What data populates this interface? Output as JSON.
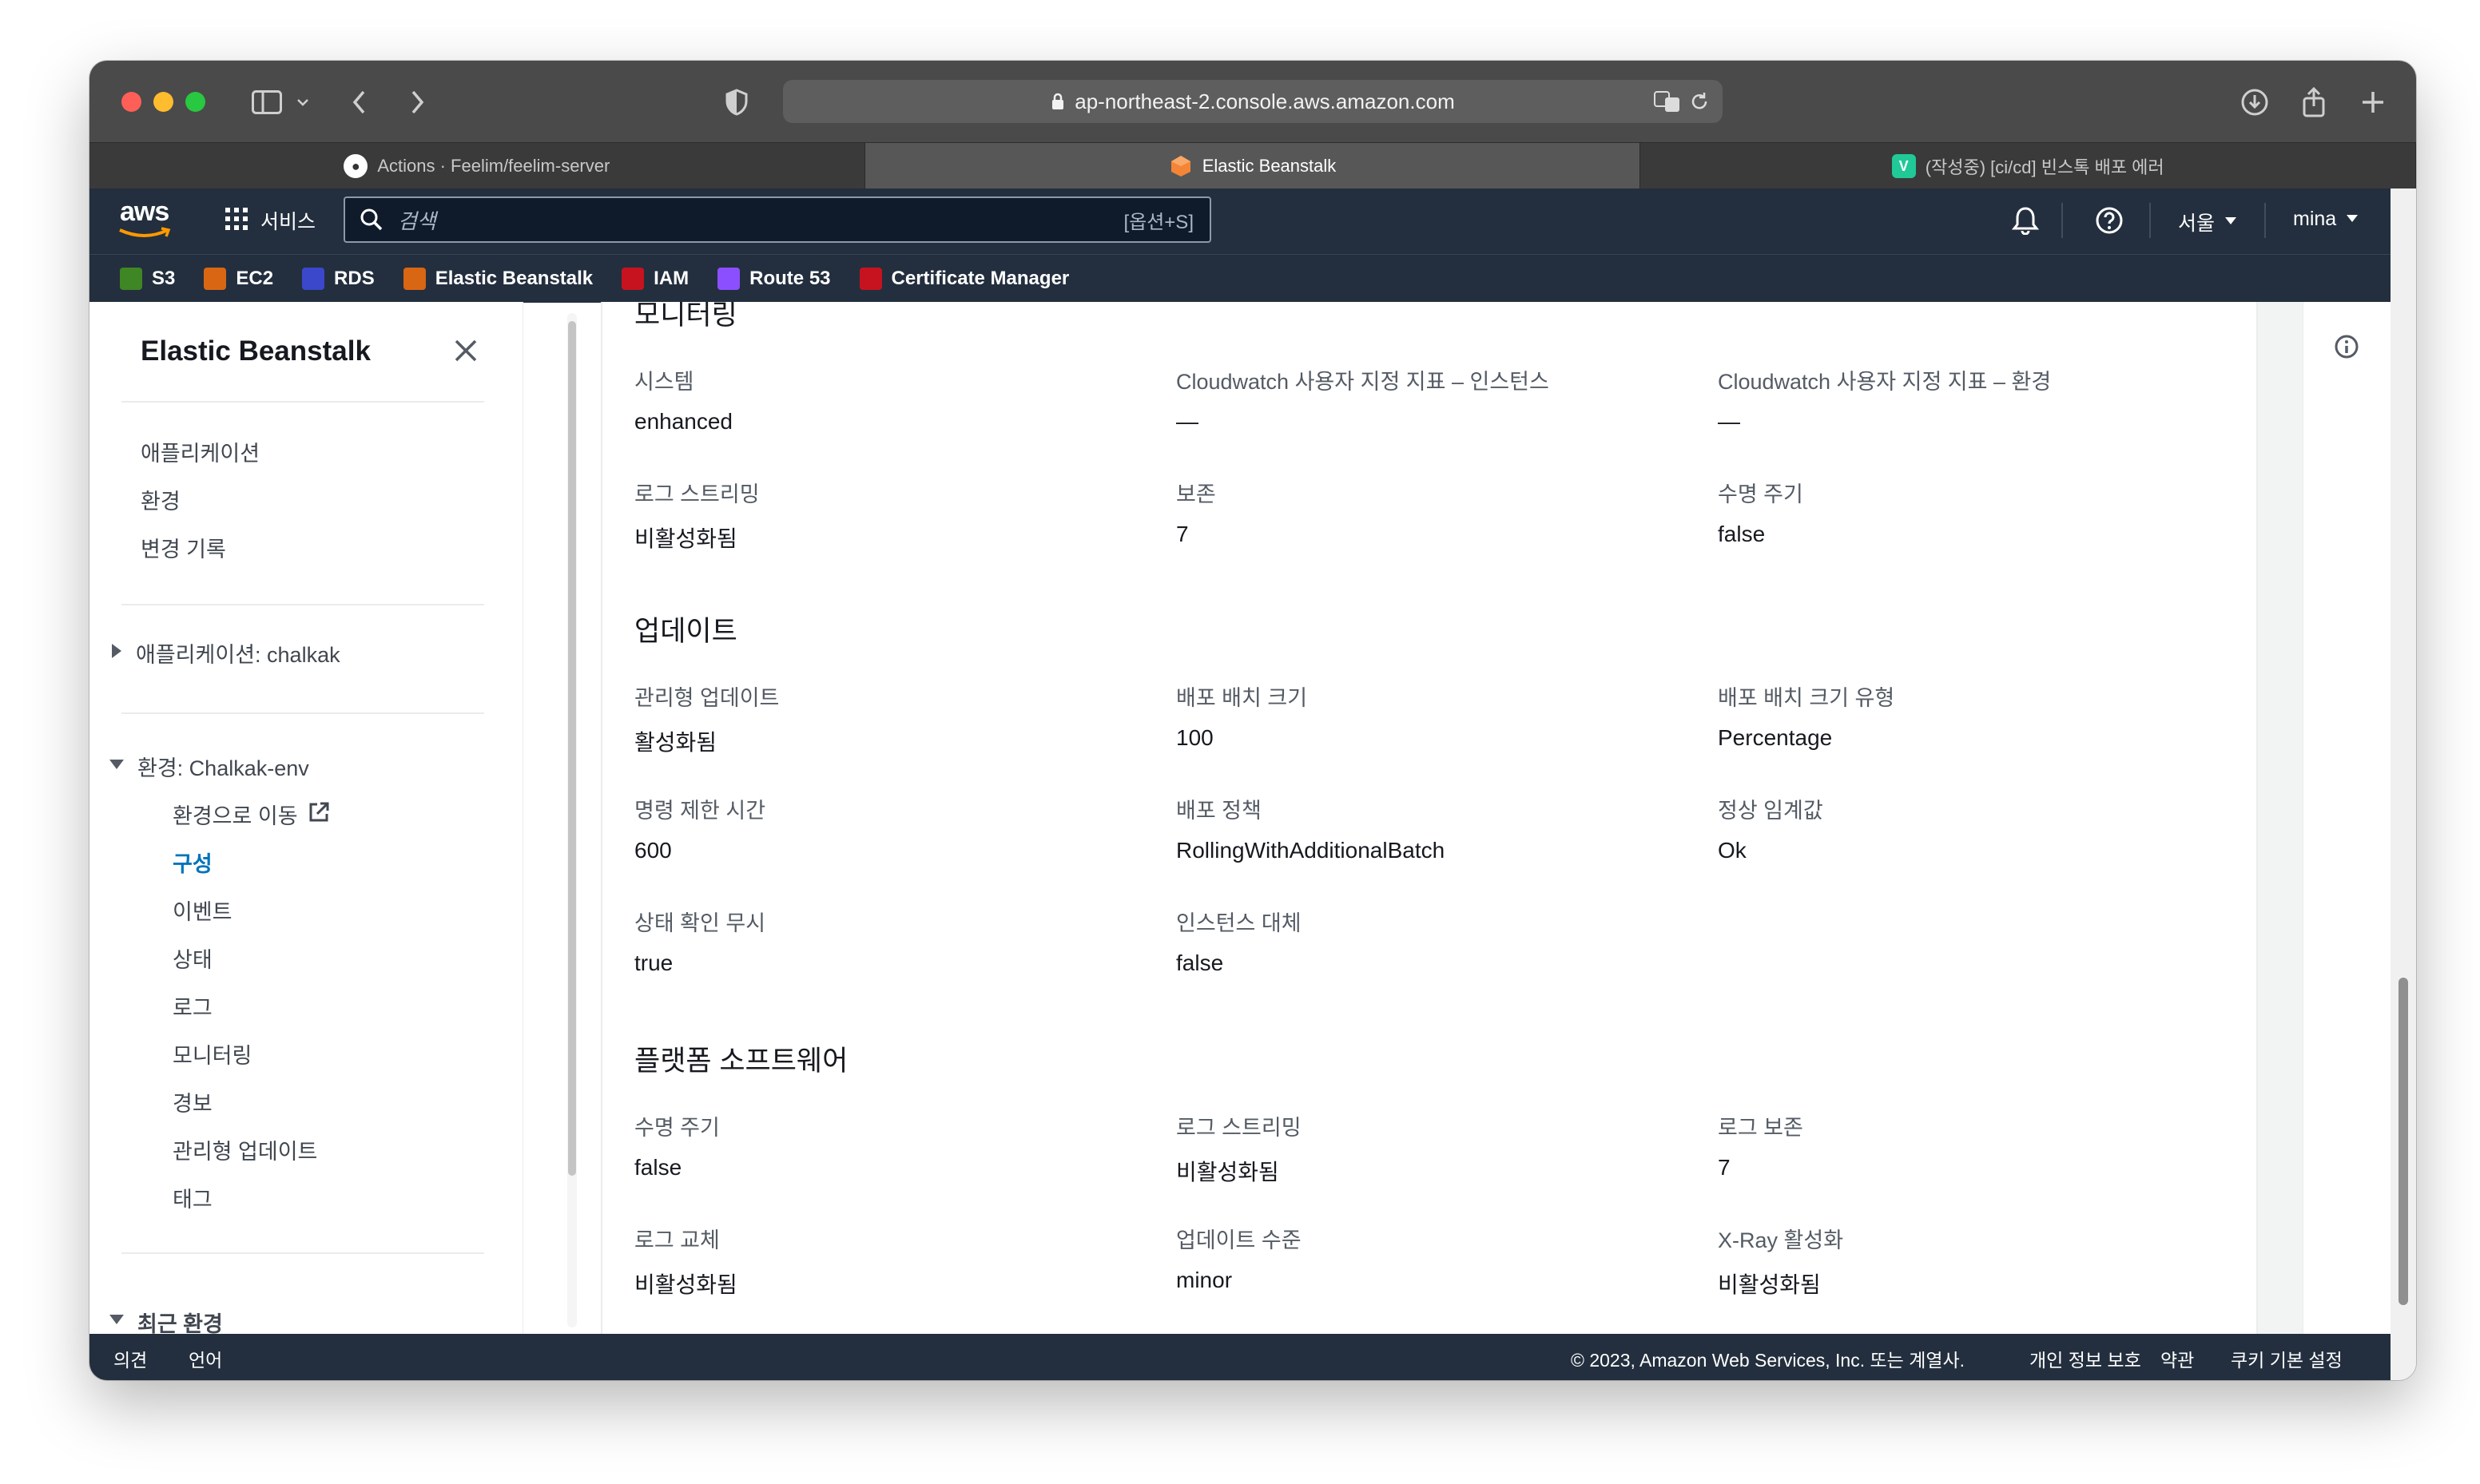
{
  "browser": {
    "url": "ap-northeast-2.console.aws.amazon.com",
    "tabs": [
      {
        "label": "Actions · Feelim/feelim-server",
        "icon": "github-icon",
        "active": false
      },
      {
        "label": "Elastic Beanstalk",
        "icon": "beanstalk-icon",
        "active": true
      },
      {
        "label": "(작성중) [ci/cd] 빈스톡 배포 에러",
        "icon": "velog-icon",
        "active": false
      }
    ]
  },
  "header": {
    "logo": "aws",
    "services": "서비스",
    "search_placeholder": "검색",
    "search_shortcut": "[옵션+S]",
    "region": "서울",
    "user": "mina"
  },
  "favorites": [
    {
      "label": "S3",
      "color": "#3f8624"
    },
    {
      "label": "EC2",
      "color": "#d86613"
    },
    {
      "label": "RDS",
      "color": "#3b48cc"
    },
    {
      "label": "Elastic Beanstalk",
      "color": "#d86613"
    },
    {
      "label": "IAM",
      "color": "#c7131f"
    },
    {
      "label": "Route 53",
      "color": "#8c4fff"
    },
    {
      "label": "Certificate Manager",
      "color": "#c7131f"
    }
  ],
  "sidebar": {
    "title": "Elastic Beanstalk",
    "top_items": [
      "애플리케이션",
      "환경",
      "변경 기록"
    ],
    "app_group": "애플리케이션: chalkak",
    "env_group": "환경: Chalkak-env",
    "env_items": [
      "환경으로 이동",
      "구성",
      "이벤트",
      "상태",
      "로그",
      "모니터링",
      "경보",
      "관리형 업데이트",
      "태그"
    ],
    "active_item": "구성",
    "recent": "최근 환경"
  },
  "sections": [
    {
      "title": "모니터링",
      "rows": [
        [
          {
            "label": "시스템",
            "value": "enhanced"
          },
          {
            "label": "Cloudwatch 사용자 지정 지표 – 인스턴스",
            "value": "—"
          },
          {
            "label": "Cloudwatch 사용자 지정 지표 – 환경",
            "value": "—"
          }
        ],
        [
          {
            "label": "로그 스트리밍",
            "value": "비활성화됨"
          },
          {
            "label": "보존",
            "value": "7"
          },
          {
            "label": "수명 주기",
            "value": "false"
          }
        ]
      ]
    },
    {
      "title": "업데이트",
      "rows": [
        [
          {
            "label": "관리형 업데이트",
            "value": "활성화됨"
          },
          {
            "label": "배포 배치 크기",
            "value": "100"
          },
          {
            "label": "배포 배치 크기 유형",
            "value": "Percentage"
          }
        ],
        [
          {
            "label": "명령 제한 시간",
            "value": "600"
          },
          {
            "label": "배포 정책",
            "value": "RollingWithAdditionalBatch"
          },
          {
            "label": "정상 임계값",
            "value": "Ok"
          }
        ],
        [
          {
            "label": "상태 확인 무시",
            "value": "true"
          },
          {
            "label": "인스턴스 대체",
            "value": "false"
          }
        ]
      ]
    },
    {
      "title": "플랫폼 소프트웨어",
      "rows": [
        [
          {
            "label": "수명 주기",
            "value": "false"
          },
          {
            "label": "로그 스트리밍",
            "value": "비활성화됨"
          },
          {
            "label": "로그 보존",
            "value": "7"
          }
        ],
        [
          {
            "label": "로그 교체",
            "value": "비활성화됨"
          },
          {
            "label": "업데이트 수준",
            "value": "minor"
          },
          {
            "label": "X-Ray 활성화",
            "value": "비활성화됨"
          }
        ]
      ]
    }
  ],
  "footer": {
    "feedback": "의견",
    "language": "언어",
    "copyright": "© 2023, Amazon Web Services, Inc. 또는 계열사.",
    "privacy": "개인 정보 보호",
    "terms": "약관",
    "cookies": "쿠키 기본 설정"
  }
}
